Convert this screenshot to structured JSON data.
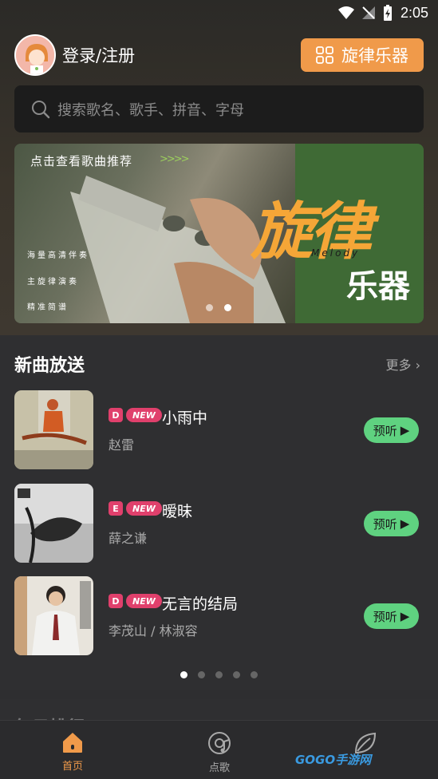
{
  "status_bar": {
    "time": "2:05"
  },
  "header": {
    "login_label": "登录/注册",
    "instrument_button_label": "旋律乐器"
  },
  "search": {
    "placeholder": "搜索歌名、歌手、拼音、字母"
  },
  "banner": {
    "tip": "点击查看歌曲推荐",
    "arrows": ">>>>",
    "features": [
      "海量高清伴奏",
      "主旋律演奏",
      "精准简谱"
    ],
    "title_big": "旋律",
    "melody_text": "Melody",
    "title_small": "乐器",
    "page_count": 2,
    "active_page": 1
  },
  "new_songs": {
    "title": "新曲放送",
    "more_label": "更多",
    "items": [
      {
        "quality": "D",
        "new_label": "NEW",
        "title": "小雨中",
        "artist": "赵雷",
        "preview_label": "预听"
      },
      {
        "quality": "E",
        "new_label": "NEW",
        "title": "暧昧",
        "artist": "薛之谦",
        "preview_label": "预听"
      },
      {
        "quality": "D",
        "new_label": "NEW",
        "title": "无言的结局",
        "artist": "李茂山 / 林淑容",
        "preview_label": "预听"
      }
    ],
    "page_count": 5,
    "active_page": 0
  },
  "next_section": {
    "title": "每日排行"
  },
  "bottom_nav": {
    "items": [
      {
        "label": "首页",
        "icon": "home-icon",
        "active": true
      },
      {
        "label": "点歌",
        "icon": "disc-icon",
        "active": false
      },
      {
        "label": "",
        "icon": "leaf-icon",
        "active": false
      }
    ]
  },
  "watermark": "GOGO手游网",
  "colors": {
    "accent": "#f09a4a",
    "preview": "#5fd280",
    "badge": "#e0406c"
  }
}
